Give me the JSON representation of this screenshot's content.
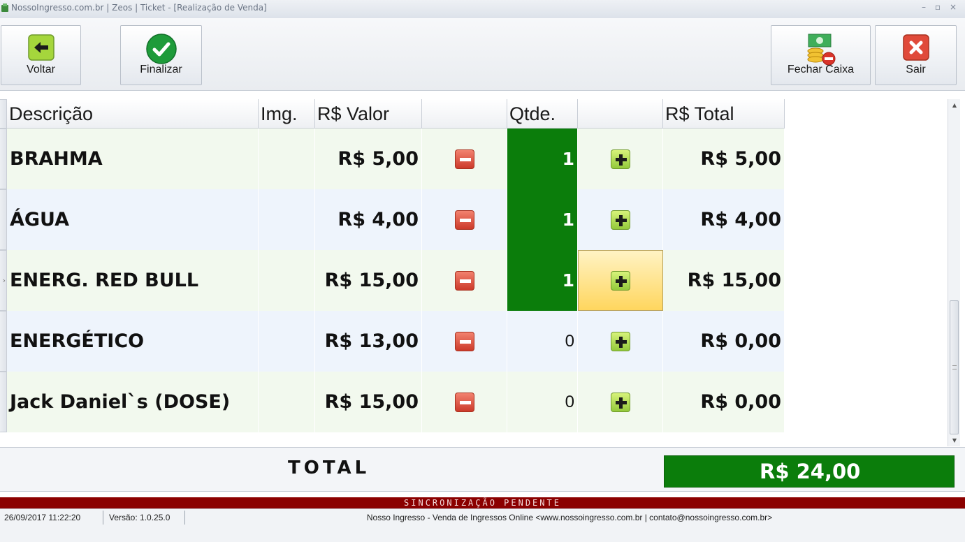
{
  "window": {
    "title": "NossoIngresso.com.br | Zeos | Ticket - [Realização de Venda]",
    "min_glyph": "–",
    "restore_glyph": "▫",
    "close_glyph": "×"
  },
  "toolbar": {
    "voltar_label": "Voltar",
    "finalizar_label": "Finalizar",
    "fechar_caixa_label": "Fechar Caixa",
    "sair_label": "Sair",
    "voltar_icon": "arrow-left-icon",
    "finalizar_icon": "check-icon",
    "fechar_caixa_icon": "cash-coins-icon",
    "sair_icon": "close-icon"
  },
  "grid": {
    "columns": {
      "descricao": "Descrição",
      "img": "Img.",
      "valor": "R$ Valor",
      "minus": "",
      "qtde": "Qtde.",
      "plus": "",
      "total": "R$ Total"
    },
    "current_row_marker": "›",
    "rows": [
      {
        "descricao": "BRAHMA",
        "valor": "R$ 5,00",
        "qtde": "1",
        "total": "R$ 5,00"
      },
      {
        "descricao": "ÁGUA",
        "valor": "R$ 4,00",
        "qtde": "1",
        "total": "R$ 4,00"
      },
      {
        "descricao": "ENERG. RED BULL",
        "valor": "R$ 15,00",
        "qtde": "1",
        "total": "R$ 15,00"
      },
      {
        "descricao": "ENERGÉTICO",
        "valor": "R$ 13,00",
        "qtde": "0",
        "total": "R$ 0,00"
      },
      {
        "descricao": "Jack Daniel`s (DOSE)",
        "valor": "R$ 15,00",
        "qtde": "0",
        "total": "R$ 0,00"
      }
    ]
  },
  "scrollbar": {
    "up_glyph": "▲",
    "down_glyph": "▼"
  },
  "total": {
    "label": "TOTAL",
    "value": "R$ 24,00"
  },
  "sync": {
    "text": "SINCRONIZAÇÃO PENDENTE"
  },
  "status": {
    "datetime": "26/09/2017 11:22:20",
    "version": "Versão: 1.0.25.0",
    "info": "Nosso Ingresso - Venda de Ingressos Online <www.nossoingresso.com.br | contato@nossoingresso.com.br>"
  },
  "colors": {
    "qty_active": "#0b7d0b",
    "total_bg": "#0b7d0b",
    "sync_bg": "#8b0000",
    "row_even": "#f2f9ee",
    "row_odd": "#eef4fc"
  }
}
